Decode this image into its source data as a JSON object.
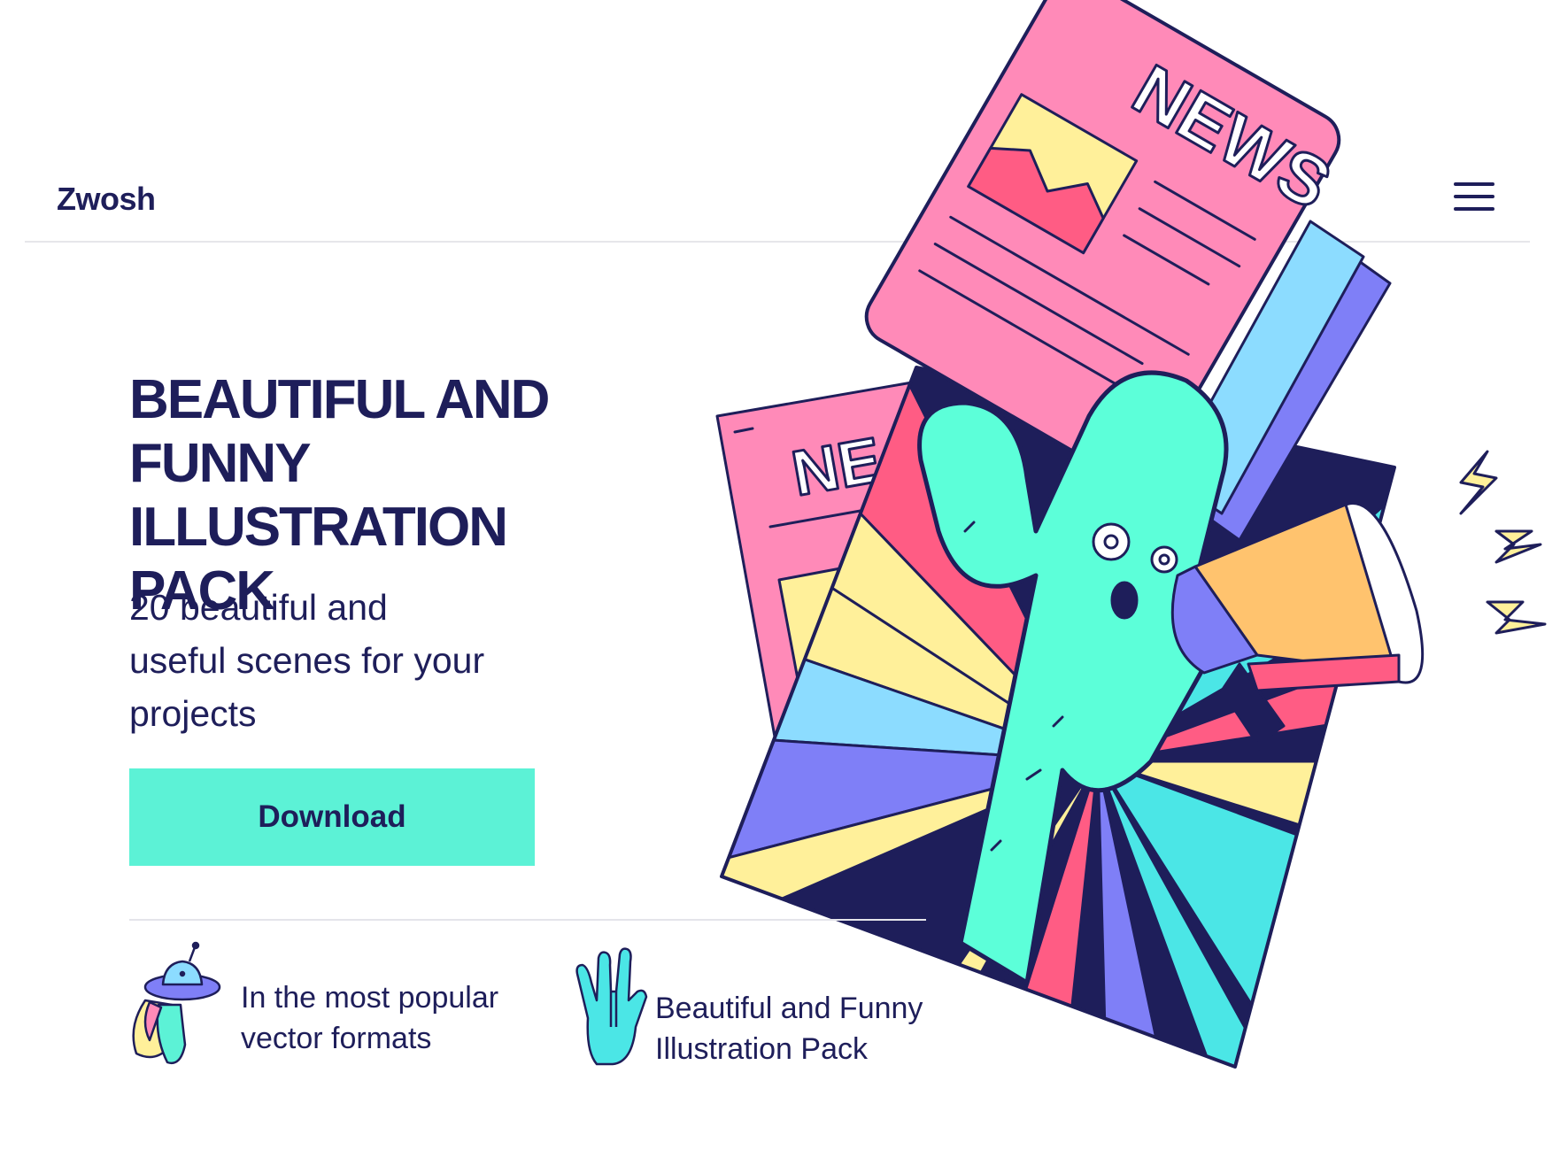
{
  "header": {
    "logo": "Zwosh",
    "menu_icon": "hamburger-menu-icon"
  },
  "hero": {
    "title_lines": [
      "BEAUTIFUL AND",
      "FUNNY ILLUSTRATION",
      "PACK"
    ],
    "subtitle_lines": [
      "20 beautiful and",
      "useful scenes for your",
      "projects"
    ],
    "cta_label": "Download"
  },
  "features": [
    {
      "icon": "ufo-icon",
      "lines": [
        "In the most popular",
        "vector formats"
      ]
    },
    {
      "icon": "vulcan-hand-icon",
      "lines": [
        "Beautiful and Funny",
        "Illustration Pack"
      ]
    }
  ],
  "illustration": {
    "newspaper_headline": "NEWS",
    "back_newspaper_headline": "NE"
  },
  "colors": {
    "navy": "#1e1e5a",
    "mint": "#5cf2d6",
    "pink": "#ff8ab8",
    "yellow": "#fff09a",
    "red": "#ff5c84",
    "lightblue": "#8cdcff",
    "purple": "#7f7ff7",
    "cyan": "#4be6e6",
    "orange": "#ffc36e"
  }
}
